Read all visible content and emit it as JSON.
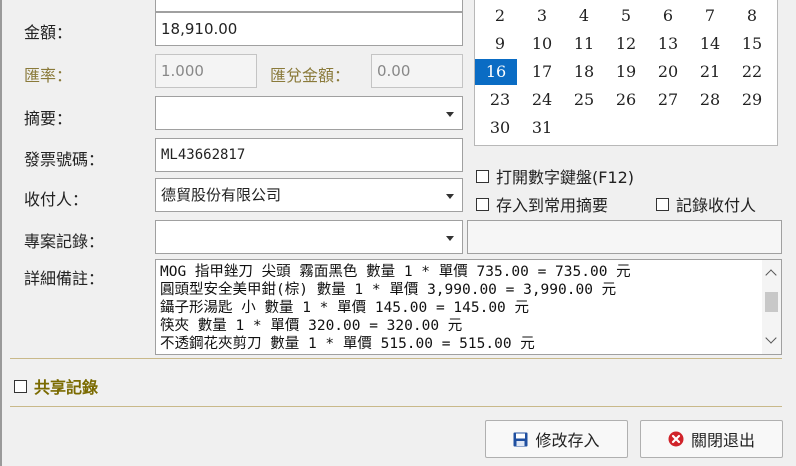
{
  "form": {
    "amount_label": "金額：",
    "amount_value": "18,910.00",
    "rate_label": "匯率：",
    "rate_value": "1.000",
    "fx_amount_label": "匯兌金額：",
    "fx_amount_value": "0.00",
    "summary_label": "摘要：",
    "summary_value": "",
    "invoice_label": "發票號碼：",
    "invoice_value": "ML43662817",
    "payee_label": "收付人：",
    "payee_value": "德貿股份有限公司",
    "project_label": "專案記錄：",
    "project_value": "",
    "project_extra_value": "",
    "details_label": "詳細備註：",
    "details_lines": [
      "MOG 指甲銼刀 尖頭 霧面黑色 數量 1 * 單價 735.00 = 735.00 元",
      "圓頭型安全美甲鉗(棕) 數量 1 * 單價 3,990.00 = 3,990.00 元",
      "鑷子形湯匙 小 數量 1 * 單價 145.00 = 145.00 元",
      "筷夾 數量 1 * 單價 320.00 = 320.00 元",
      "不透鋼花夾剪刀 數量 1 * 單價 515.00 = 515.00 元"
    ]
  },
  "calendar": {
    "rows": [
      [
        "2",
        "3",
        "4",
        "5",
        "6",
        "7",
        "8"
      ],
      [
        "9",
        "10",
        "11",
        "12",
        "13",
        "14",
        "15"
      ],
      [
        "16",
        "17",
        "18",
        "19",
        "20",
        "21",
        "22"
      ],
      [
        "23",
        "24",
        "25",
        "26",
        "27",
        "28",
        "29"
      ],
      [
        "30",
        "31"
      ]
    ],
    "selected_day": "16",
    "selected_color": "#0a6cc4"
  },
  "options": {
    "numeric_keypad": "打開數字鍵盤(F12)",
    "save_common_summary": "存入到常用摘要",
    "record_payee": "記錄收付人",
    "share_record": "共享記錄"
  },
  "buttons": {
    "save_label": "修改存入",
    "close_label": "關閉退出"
  },
  "colors": {
    "accent": "#0a6cc4",
    "share_text": "#7a6a00",
    "close_icon": "#d0232a",
    "save_icon": "#1f4fa0"
  }
}
